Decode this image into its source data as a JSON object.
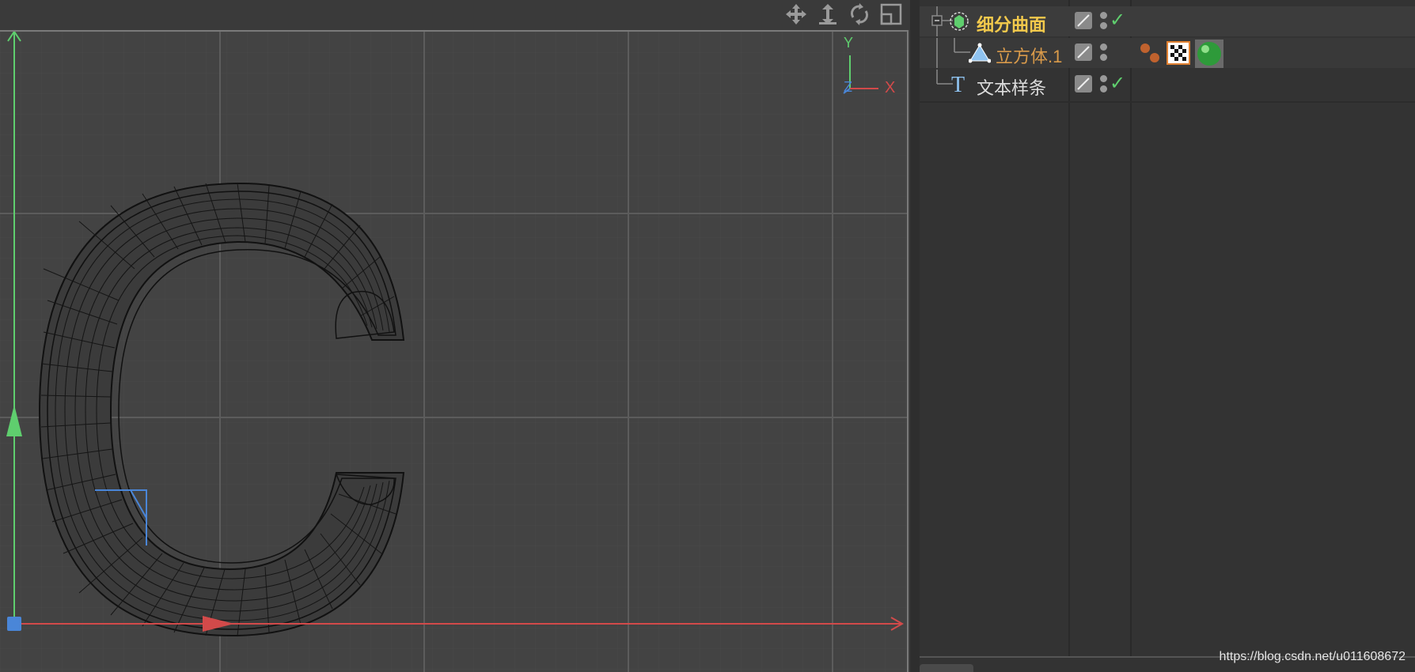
{
  "viewport": {
    "tools": [
      {
        "name": "move-view-icon",
        "glyph": "✥"
      },
      {
        "name": "zoom-view-icon",
        "glyph": "⇕"
      },
      {
        "name": "rotate-view-icon",
        "glyph": "⟲"
      },
      {
        "name": "maximize-view-icon",
        "glyph": "▣"
      }
    ],
    "axis_gizmo": {
      "y": "Y",
      "z": "Z",
      "x": "X"
    },
    "colors": {
      "y_axis": "#5fce6e",
      "x_axis": "#d24a4a",
      "z_axis": "#4a86d8",
      "grid": "#555555"
    }
  },
  "object_manager": {
    "rows": [
      {
        "label": "细分曲面",
        "color": "#f2c94c",
        "icon": "subdivision-surface-icon",
        "check": true,
        "tags": []
      },
      {
        "label": "立方体.1",
        "color": "#d99a4a",
        "icon": "cube-icon",
        "check": false,
        "tags": [
          "material-tag-icon",
          "checker-texture-tag-icon",
          "green-sphere-material-icon"
        ]
      },
      {
        "label": "文本样条",
        "color": "#dddddd",
        "icon": "text-spline-icon",
        "check": true,
        "tags": []
      }
    ]
  },
  "watermark": "https://blog.csdn.net/u011608672"
}
